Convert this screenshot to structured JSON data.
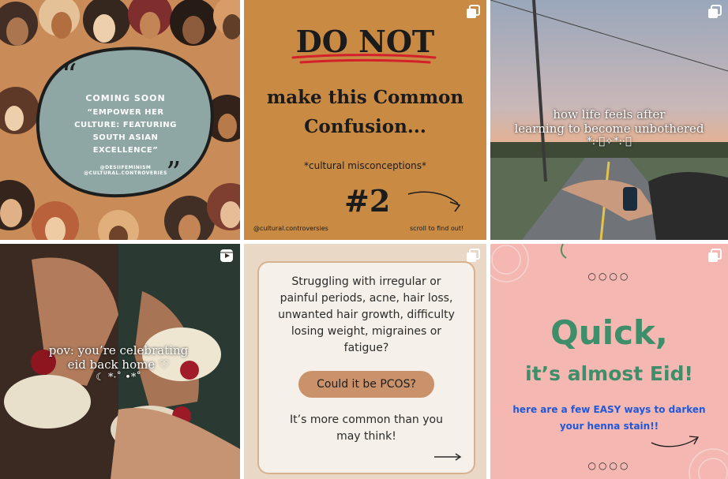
{
  "posts": [
    {
      "heading": "COMING SOON",
      "quote": "“EMPOWER HER CULTURE: FEATURING SOUTH ASIAN EXCELLENCE”",
      "handle1": "@DESIIFEMINISM",
      "handle2": "@CULTURAL.CONTROVERIES",
      "colors": {
        "blob": "#8fa7a4",
        "background": "#d9b48a"
      }
    },
    {
      "title": "DO NOT",
      "line1": "make this Common",
      "line2": "Confusion...",
      "subtitle": "*cultural misconceptions*",
      "number": "#2",
      "footer_left": "@cultural.controversies",
      "footer_right": "scroll to find out!",
      "icon": "carousel-icon",
      "colors": {
        "background": "#c98a44",
        "underline": "#d3202a"
      }
    },
    {
      "caption_line1": "how life feels after",
      "caption_line2": "learning to become unbothered",
      "caption_line3": "*:·ﾟ✧*:·ﾟ",
      "icon": "carousel-icon"
    },
    {
      "caption_line1": "pov: you’re celebrating",
      "caption_line2": "eid back home ♡",
      "caption_line3": "☾ *·˚ •*˚",
      "icon": "reel-icon"
    },
    {
      "question": "Struggling with irregular or painful periods, acne, hair loss, unwanted hair growth, difficulty losing weight, migraines or fatigue?",
      "button": "Could it be PCOS?",
      "footer": "It’s more common than you may think!",
      "icon": "carousel-icon",
      "colors": {
        "card": "#f5f0e9",
        "button": "#c9926a",
        "border": "#d8b28f"
      }
    },
    {
      "title": "Quick,",
      "subtitle": "it’s almost Eid!",
      "body": "here are a few EASY ways to darken your henna stain!!",
      "dots": "○○○○",
      "icon": "carousel-icon",
      "colors": {
        "background": "#f4b7b2",
        "title": "#3f8e6a",
        "body": "#1f58d8"
      }
    }
  ]
}
